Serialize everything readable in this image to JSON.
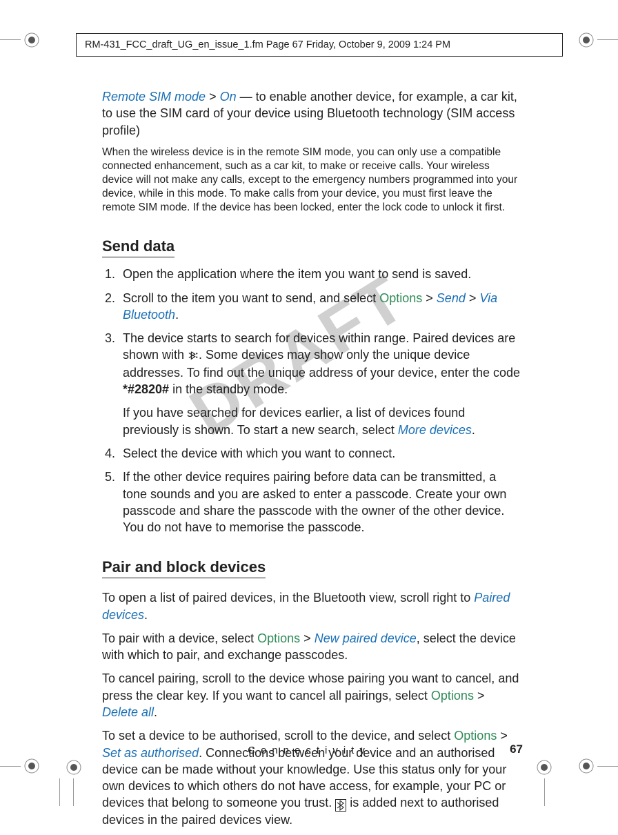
{
  "header": {
    "line": "RM-431_FCC_draft_UG_en_issue_1.fm  Page 67  Friday, October 9, 2009  1:24 PM"
  },
  "watermark": "DRAFT",
  "intro": {
    "sim_mode": "Remote SIM mode",
    "on": "On",
    "sim_text": " — to enable another device, for example, a car kit, to use the SIM card of your device using Bluetooth technology (SIM access profile)",
    "note": "When the wireless device is in the remote SIM mode, you can only use a compatible connected enhancement, such as a car kit, to make or receive calls. Your wireless device will not make any calls, except to the emergency numbers programmed into your device, while in this mode. To make calls from your device, you must first leave the remote SIM mode. If the device has been locked, enter the lock code to unlock it first."
  },
  "send": {
    "heading": "Send data",
    "step1": "Open the application where the item you want to send is saved.",
    "step2a": "Scroll to the item you want to send, and select ",
    "options": "Options",
    "send": "Send",
    "via_bt": "Via Bluetooth",
    "step3a": "The device starts to search for devices within range. Paired devices are shown with ",
    "step3b": ". Some devices may show only the unique device addresses. To find out the unique address of your device, enter the code ",
    "code": "*#2820#",
    "step3c": " in the standby mode.",
    "step3d": "If you have searched for devices earlier, a list of devices found previously is shown. To start a new search, select ",
    "more_devices": "More devices",
    "step4": "Select the device with which you want to connect.",
    "step5": "If the other device requires pairing before data can be transmitted, a tone sounds and you are asked to enter a passcode. Create your own passcode and share the passcode with the owner of the other device. You do not have to memorise the passcode."
  },
  "pair": {
    "heading": "Pair and block devices",
    "p1a": "To open a list of paired devices, in the Bluetooth view, scroll right to ",
    "paired_devices": "Paired devices",
    "p2a": "To pair with a device, select ",
    "options": "Options",
    "new_paired": "New paired device",
    "p2b": ", select the device with which to pair, and exchange passcodes.",
    "p3a": "To cancel pairing, scroll to the device whose pairing you want to cancel, and press the clear key. If you want to cancel all pairings, select ",
    "delete_all": "Delete all",
    "p4a": "To set a device to be authorised, scroll to the device, and select ",
    "set_auth": "Set as authorised",
    "p4b": ". Connections between your device and an authorised device can be made without your knowledge. Use this status only for your own devices to which others do not have access, for example, your PC or devices that belong to someone you trust. ",
    "p4c": " is added next to authorised devices in the paired devices view."
  },
  "footer": {
    "section": "Connectivity",
    "page": "67"
  },
  "gt": ">"
}
